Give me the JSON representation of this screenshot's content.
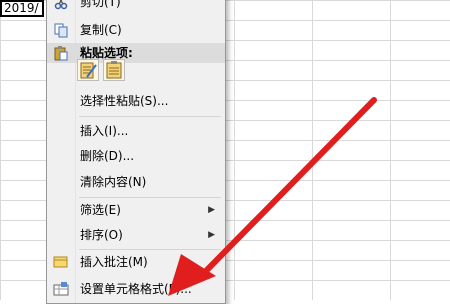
{
  "cell": {
    "text": "2019/"
  },
  "menu": {
    "items": [
      {
        "label": "剪切(T)",
        "icon": "scissors-icon"
      },
      {
        "label": "复制(C)",
        "icon": "copy-icon"
      },
      {
        "label": "粘贴选项:",
        "icon": "paste-icon"
      },
      {
        "label": "选择性粘贴(S)..."
      },
      {
        "label": "插入(I)..."
      },
      {
        "label": "删除(D)..."
      },
      {
        "label": "清除内容(N)"
      },
      {
        "label": "筛选(E)"
      },
      {
        "label": "排序(O)"
      },
      {
        "label": "插入批注(M)",
        "icon": "comment-icon"
      },
      {
        "label": "设置单元格格式(F)...",
        "icon": "format-cells-icon"
      }
    ],
    "paste_options": [
      "paste-format-icon",
      "paste-values-icon"
    ]
  },
  "annotation": {
    "color": "#e01e1e"
  }
}
